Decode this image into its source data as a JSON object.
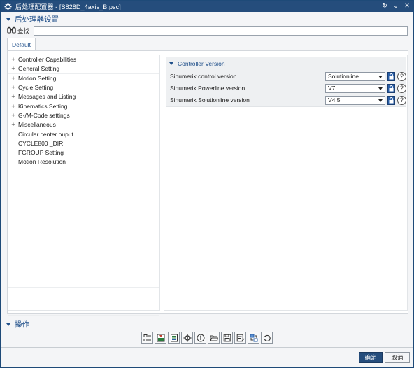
{
  "window": {
    "title": "后处理配置器 - [S828D_4axis_B.psc]",
    "controls": [
      "↻",
      "⌄",
      "✕"
    ]
  },
  "settings": {
    "heading": "后处理器设置",
    "find_label": "查找",
    "find_value": "",
    "tab": "Default"
  },
  "tree": {
    "items": [
      {
        "label": "Controller Capabilities",
        "expandable": true
      },
      {
        "label": "General Setting",
        "expandable": true
      },
      {
        "label": "Motion Setting",
        "expandable": true
      },
      {
        "label": "Cycle Setting",
        "expandable": true
      },
      {
        "label": "Messages and Listing",
        "expandable": true
      },
      {
        "label": "Kinematics Setting",
        "expandable": true
      },
      {
        "label": "G-/M-Code settings",
        "expandable": true
      },
      {
        "label": "Miscellaneous",
        "expandable": true
      },
      {
        "label": "Circular center ouput",
        "expandable": false
      },
      {
        "label": "CYCLE800 _DIR",
        "expandable": false
      },
      {
        "label": "FGROUP Setting",
        "expandable": false
      },
      {
        "label": "Motion Resolution",
        "expandable": false
      }
    ]
  },
  "controller_version": {
    "title": "Controller Version",
    "rows": [
      {
        "label": "Sinumerik control version",
        "value": "Solutionline"
      },
      {
        "label": "Sinumerik Powerline version",
        "value": "V7"
      },
      {
        "label": "Sinumerik Solutionline version",
        "value": "V4.5"
      }
    ],
    "help_glyph": "?"
  },
  "operations": {
    "heading": "操作",
    "icons": [
      "list-icon",
      "export-icon",
      "report-icon",
      "settings-icon",
      "info-icon",
      "open-folder-icon",
      "save-icon",
      "save-as-icon",
      "swap-icon",
      "undo-icon"
    ]
  },
  "buttons": {
    "ok": "确定",
    "cancel": "取消"
  },
  "colors": {
    "titlebar": "#254d7c",
    "accent": "#1f4f8a",
    "ok_button": "#254d7c"
  }
}
